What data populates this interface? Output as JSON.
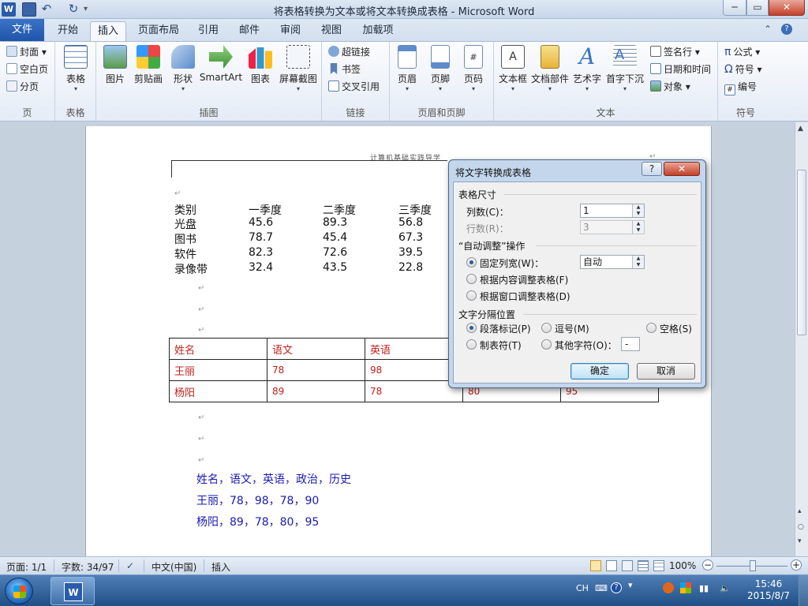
{
  "window": {
    "title": "将表格转换为文本或将文本转换成表格 - Microsoft Word",
    "logo": "W",
    "controls": {
      "minimize": "─",
      "maximize": "▭",
      "close": "✕"
    }
  },
  "tabs": {
    "file": "文件",
    "items": [
      "开始",
      "插入",
      "页面布局",
      "引用",
      "邮件",
      "审阅",
      "视图",
      "加载项"
    ],
    "active": "插入"
  },
  "ribbon": {
    "pages_group": {
      "label": "页",
      "items": [
        "封面",
        "空白页",
        "分页"
      ]
    },
    "table_group": {
      "label": "表格",
      "button": "表格"
    },
    "illustrations_group": {
      "label": "插图",
      "buttons": [
        "图片",
        "剪贴画",
        "形状",
        "SmartArt",
        "图表",
        "屏幕截图"
      ]
    },
    "links_group": {
      "label": "链接",
      "items": [
        "超链接",
        "书签",
        "交叉引用"
      ]
    },
    "header_footer_group": {
      "label": "页眉和页脚",
      "buttons": [
        "页眉",
        "页脚",
        "页码"
      ]
    },
    "text_group": {
      "label": "文本",
      "buttons": [
        "文本框",
        "文档部件",
        "艺术字",
        "首字下沉"
      ],
      "items": [
        "签名行",
        "日期和时间",
        "对象"
      ]
    },
    "symbols_group": {
      "label": "符号",
      "items": [
        "公式",
        "符号",
        "编号"
      ]
    }
  },
  "document": {
    "header_text": "计算机基础实践导学",
    "sales_table": {
      "headers": [
        "类别",
        "一季度",
        "二季度",
        "三季度"
      ],
      "rows": [
        [
          "光盘",
          "45.6",
          "89.3",
          "56.8"
        ],
        [
          "图书",
          "78.7",
          "45.4",
          "67.3"
        ],
        [
          "软件",
          "82.3",
          "72.6",
          "39.5"
        ],
        [
          "录像带",
          "32.4",
          "43.5",
          "22.8"
        ]
      ]
    },
    "grade_table": {
      "rows": [
        [
          "姓名",
          "语文",
          "英语",
          "",
          ""
        ],
        [
          "王丽",
          "78",
          "98",
          "",
          ""
        ],
        [
          "杨阳",
          "89",
          "78",
          "80",
          "95"
        ]
      ]
    },
    "text_lines": [
      "姓名，语文，英语，政治，历史",
      "王丽，78，98，78，90",
      "杨阳，89，78，80，95"
    ],
    "para_mark": "↵"
  },
  "dialog": {
    "title": "将文字转换成表格",
    "help": "?",
    "close": "✕",
    "size_section": "表格尺寸",
    "columns_label": "列数(C)：",
    "columns_value": "1",
    "rows_label": "行数(R)：",
    "rows_value": "3",
    "autofit_section": "“自动调整”操作",
    "fixed_width_label": "固定列宽(W)：",
    "fixed_width_value": "自动",
    "autofit_content_label": "根据内容调整表格(F)",
    "autofit_window_label": "根据窗口调整表格(D)",
    "separator_section": "文字分隔位置",
    "sep_paragraph": "段落标记(P)",
    "sep_comma": "逗号(M)",
    "sep_space": "空格(S)",
    "sep_tab": "制表符(T)",
    "sep_other": "其他字符(O)：",
    "sep_other_value": "-",
    "ok": "确定",
    "cancel": "取消"
  },
  "statusbar": {
    "page": "页面: 1/1",
    "words": "字数: 34/97",
    "language": "中文(中国)",
    "mode": "插入",
    "zoom": "100%"
  },
  "taskbar": {
    "ime": "CH",
    "time": "15:46",
    "date": "2015/8/7"
  }
}
